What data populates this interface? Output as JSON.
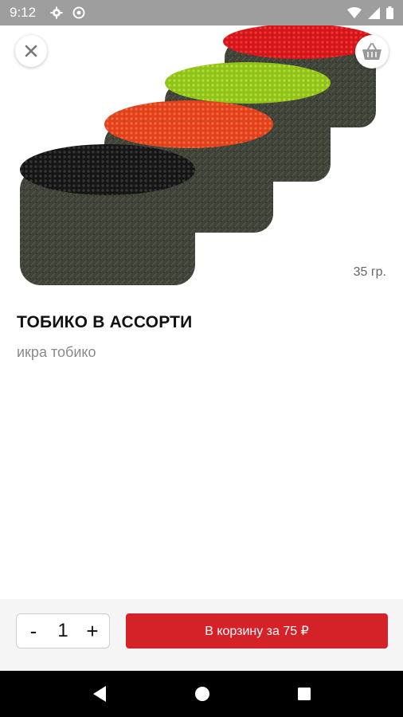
{
  "status_bar": {
    "time": "9:12",
    "icons": [
      "gear-icon",
      "do-not-disturb-icon",
      "wifi-icon",
      "signal-icon",
      "battery-icon"
    ]
  },
  "product": {
    "weight": "35 гр.",
    "title": "ТОБИКО В АССОРТИ",
    "description": "икра тобико",
    "image_subject": "tobiko-gunkan-assortment"
  },
  "header": {
    "close_icon": "close-icon",
    "cart_icon": "basket-icon"
  },
  "order": {
    "decrement_label": "-",
    "quantity": "1",
    "increment_label": "+",
    "add_to_cart_label": "В корзину за 75 ₽"
  },
  "nav_bar": {
    "icons": [
      "back-icon",
      "home-icon",
      "recents-icon"
    ]
  },
  "colors": {
    "accent": "#d52128",
    "status_bar": "#9e9e9e",
    "nav_bar": "#000000"
  }
}
